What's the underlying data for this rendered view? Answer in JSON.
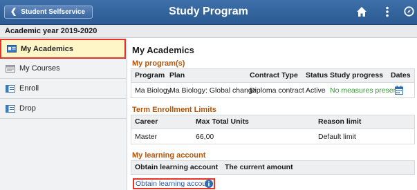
{
  "header": {
    "back_label": "Student Selfservice",
    "title": "Study Program",
    "bg_color": "#2f5e96"
  },
  "subheader": {
    "label": "Academic year 2019-2020"
  },
  "sidebar": {
    "items": [
      {
        "label": "My Academics",
        "icon": "id-card-icon",
        "active": true
      },
      {
        "label": "My Courses",
        "icon": "courses-icon",
        "active": false
      },
      {
        "label": "Enroll",
        "icon": "enroll-icon",
        "active": false
      },
      {
        "label": "Drop",
        "icon": "drop-icon",
        "active": false
      }
    ]
  },
  "main": {
    "title": "My Academics",
    "programs": {
      "title": "My program(s)",
      "headers": [
        "Program",
        "Plan",
        "Contract Type",
        "Status",
        "Study progress",
        "Dates"
      ],
      "rows": [
        {
          "program": "Ma Biology",
          "plan": "Ma Biology: Global change",
          "contract": "Diploma contract",
          "status": "Active",
          "progress": "No measures present",
          "dates_icon": "calendar-icon"
        }
      ]
    },
    "limits": {
      "title": "Term Enrollment Limits",
      "headers": [
        "Career",
        "Max Total Units",
        "Reason limit"
      ],
      "rows": [
        {
          "career": "Master",
          "units": "66,00",
          "reason": "Default limit"
        }
      ]
    },
    "learning": {
      "title": "My learning account",
      "headers": [
        "Obtain learning account",
        "The current amount"
      ],
      "link": "Obtain learning account",
      "info_icon": "info-icon"
    }
  },
  "colors": {
    "accent": "#b7560b",
    "link": "#2559a8",
    "positive": "#2e9b2e",
    "highlight_border": "#e5332a"
  }
}
